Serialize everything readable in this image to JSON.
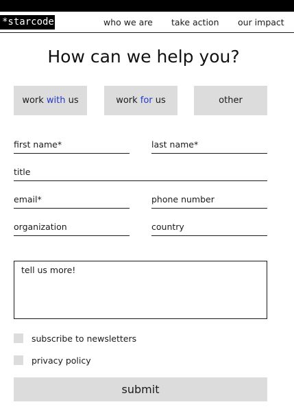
{
  "brand": {
    "logo_text": "*starcode"
  },
  "nav": {
    "links": [
      "who we are",
      "take action",
      "our impact"
    ]
  },
  "heading": "How can we help you?",
  "options": [
    {
      "pre": "work ",
      "accent": "with",
      "post": " us"
    },
    {
      "pre": "work ",
      "accent": "for",
      "post": " us"
    },
    {
      "pre": "",
      "accent": "",
      "post": "other"
    }
  ],
  "form": {
    "first_name": "first name*",
    "last_name": "last name*",
    "title": "title",
    "email": "email*",
    "phone": "phone number",
    "organization": "organization",
    "country": "country",
    "message_placeholder": "tell us more!",
    "subscribe_label": "subscribe to newsletters",
    "privacy_label": "privacy policy",
    "submit_label": "submit"
  },
  "colors": {
    "accent": "#2238c8",
    "button_bg": "#dcdcdc",
    "topbar": "#000000"
  }
}
